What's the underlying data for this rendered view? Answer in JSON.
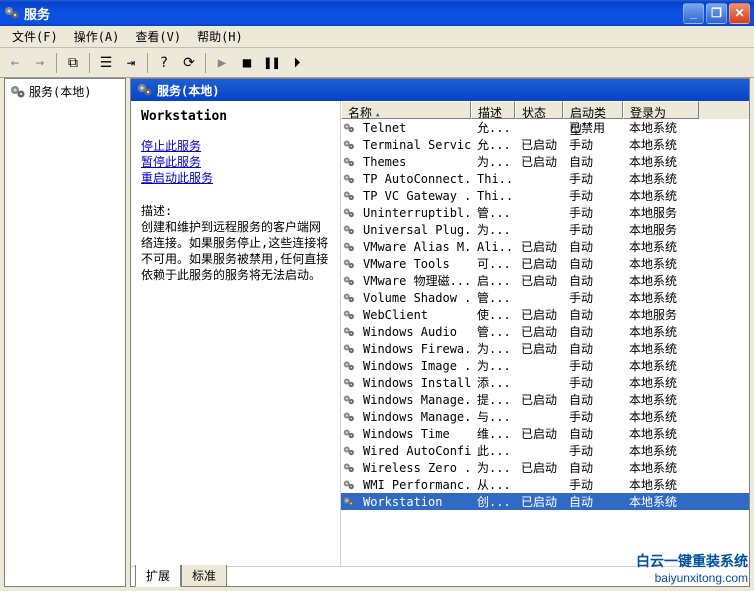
{
  "window": {
    "title": "服务"
  },
  "menus": {
    "file": "文件(F)",
    "action": "操作(A)",
    "view": "查看(V)",
    "help": "帮助(H)"
  },
  "tree": {
    "root": "服务(本地)"
  },
  "content_header": "服务(本地)",
  "detail": {
    "selected_name": "Workstation",
    "action_stop": "停止此服务",
    "action_pause": "暂停此服务",
    "action_restart": "重启动此服务",
    "desc_label": "描述:",
    "desc_text": "创建和维护到远程服务的客户端网络连接。如果服务停止,这些连接将不可用。如果服务被禁用,任何直接依赖于此服务的服务将无法启动。"
  },
  "columns": {
    "name": "名称",
    "desc": "描述",
    "status": "状态",
    "startup": "启动类型",
    "logon": "登录为"
  },
  "services": [
    {
      "name": "Telnet",
      "desc": "允...",
      "status": "",
      "startup": "已禁用",
      "logon": "本地系统"
    },
    {
      "name": "Terminal Services",
      "desc": "允...",
      "status": "已启动",
      "startup": "手动",
      "logon": "本地系统"
    },
    {
      "name": "Themes",
      "desc": "为...",
      "status": "已启动",
      "startup": "自动",
      "logon": "本地系统"
    },
    {
      "name": "TP AutoConnect...",
      "desc": "Thi...",
      "status": "",
      "startup": "手动",
      "logon": "本地系统"
    },
    {
      "name": "TP VC Gateway ...",
      "desc": "Thi...",
      "status": "",
      "startup": "手动",
      "logon": "本地系统"
    },
    {
      "name": "Uninterruptibl...",
      "desc": "管...",
      "status": "",
      "startup": "手动",
      "logon": "本地服务"
    },
    {
      "name": "Universal Plug...",
      "desc": "为...",
      "status": "",
      "startup": "手动",
      "logon": "本地服务"
    },
    {
      "name": "VMware Alias M...",
      "desc": "Ali...",
      "status": "已启动",
      "startup": "自动",
      "logon": "本地系统"
    },
    {
      "name": "VMware Tools",
      "desc": "可...",
      "status": "已启动",
      "startup": "自动",
      "logon": "本地系统"
    },
    {
      "name": "VMware 物理磁...",
      "desc": "启...",
      "status": "已启动",
      "startup": "自动",
      "logon": "本地系统"
    },
    {
      "name": "Volume Shadow ...",
      "desc": "管...",
      "status": "",
      "startup": "手动",
      "logon": "本地系统"
    },
    {
      "name": "WebClient",
      "desc": "使...",
      "status": "已启动",
      "startup": "自动",
      "logon": "本地服务"
    },
    {
      "name": "Windows Audio",
      "desc": "管...",
      "status": "已启动",
      "startup": "自动",
      "logon": "本地系统"
    },
    {
      "name": "Windows Firewa...",
      "desc": "为...",
      "status": "已启动",
      "startup": "自动",
      "logon": "本地系统"
    },
    {
      "name": "Windows Image ...",
      "desc": "为...",
      "status": "",
      "startup": "手动",
      "logon": "本地系统"
    },
    {
      "name": "Windows Installer",
      "desc": "添...",
      "status": "",
      "startup": "手动",
      "logon": "本地系统"
    },
    {
      "name": "Windows Manage...",
      "desc": "提...",
      "status": "已启动",
      "startup": "自动",
      "logon": "本地系统"
    },
    {
      "name": "Windows Manage...",
      "desc": "与...",
      "status": "",
      "startup": "手动",
      "logon": "本地系统"
    },
    {
      "name": "Windows Time",
      "desc": "维...",
      "status": "已启动",
      "startup": "自动",
      "logon": "本地系统"
    },
    {
      "name": "Wired AutoConfig",
      "desc": "此...",
      "status": "",
      "startup": "手动",
      "logon": "本地系统"
    },
    {
      "name": "Wireless Zero ...",
      "desc": "为...",
      "status": "已启动",
      "startup": "自动",
      "logon": "本地系统"
    },
    {
      "name": "WMI Performanc...",
      "desc": "从...",
      "status": "",
      "startup": "手动",
      "logon": "本地系统"
    },
    {
      "name": "Workstation",
      "desc": "创...",
      "status": "已启动",
      "startup": "自动",
      "logon": "本地系统",
      "selected": true
    }
  ],
  "tabs": {
    "extended": "扩展",
    "standard": "标准"
  },
  "watermark": {
    "line1": "白云一键重装系统",
    "line2": "baiyunxitong.com"
  }
}
